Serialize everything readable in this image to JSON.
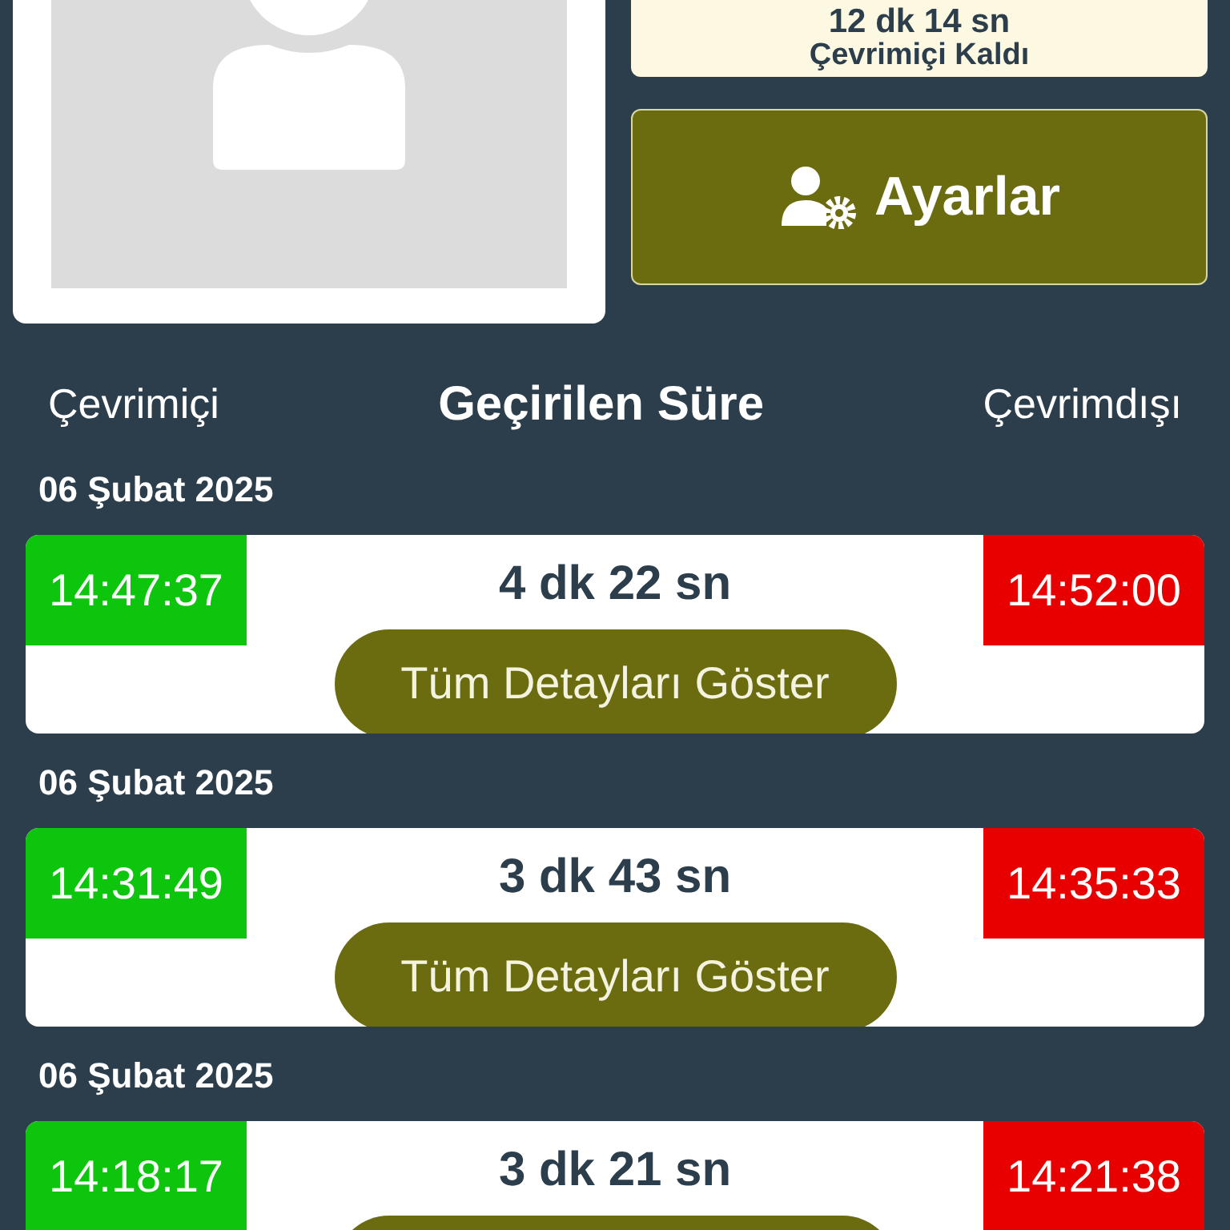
{
  "summary": {
    "duration": "12 dk 14 sn",
    "label": "Çevrimiçi Kaldı"
  },
  "settings_button": {
    "label": "Ayarlar"
  },
  "header": {
    "online": "Çevrimiçi",
    "spent": "Geçirilen Süre",
    "offline": "Çevrimdışı"
  },
  "sessions": [
    {
      "date": "06 Şubat 2025",
      "online": "14:47:37",
      "duration": "4 dk 22 sn",
      "offline": "14:52:00",
      "button_label": "Tüm Detayları Göster"
    },
    {
      "date": "06 Şubat 2025",
      "online": "14:31:49",
      "duration": "3 dk 43 sn",
      "offline": "14:35:33",
      "button_label": "Tüm Detayları Göster"
    },
    {
      "date": "06 Şubat 2025",
      "online": "14:18:17",
      "duration": "3 dk 21 sn",
      "offline": "14:21:38"
    }
  ]
}
